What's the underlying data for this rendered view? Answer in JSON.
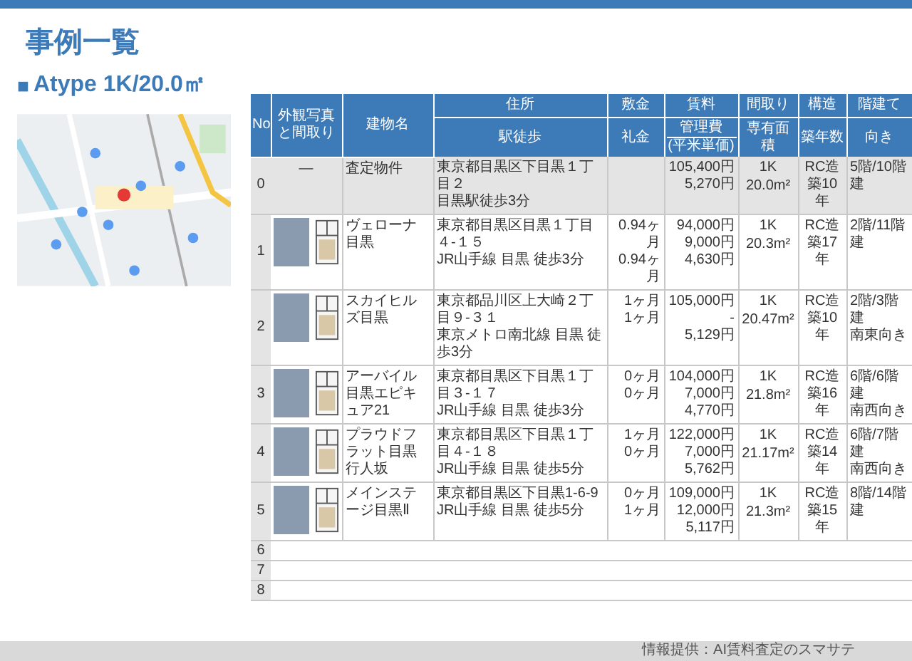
{
  "title": "事例一覧",
  "subtitle": {
    "marker": "■",
    "text": "Atype 1K/20.0㎡"
  },
  "table": {
    "columns": [
      {
        "label": "No"
      },
      {
        "label": "外観写真と間取り"
      },
      {
        "label": "建物名"
      },
      {
        "label": "住所",
        "sub": [
          "駅徒歩"
        ]
      },
      {
        "label": "敷金",
        "sub": [
          "礼金"
        ]
      },
      {
        "label": "賃料",
        "sub": [
          "管理費",
          "(平米単価)"
        ]
      },
      {
        "label": "間取り",
        "sub": [
          "専有面積"
        ]
      },
      {
        "label": "構造",
        "sub": [
          "築年数"
        ]
      },
      {
        "label": "階建て",
        "sub": [
          "向き"
        ]
      }
    ],
    "rows": [
      {
        "kind": "subject",
        "no": "0",
        "photo_text": "—",
        "name": "査定物件",
        "address": "東京都目黒区下目黒１丁目２",
        "station": "目黒駅徒歩3分",
        "deposit": "",
        "key_money": "",
        "rent": "105,400円",
        "fee": "",
        "unit_price": "5,270円",
        "layout": "1K",
        "area": "20.0m²",
        "structure": "RC造",
        "age": "築10年",
        "floor": "5階/10階建",
        "direction": ""
      },
      {
        "kind": "case",
        "no": "1",
        "name": "ヴェローナ目黒",
        "address": "東京都目黒区目黒１丁目４-１５",
        "station": "JR山手線 目黒 徒歩3分",
        "deposit": "0.94ヶ月",
        "key_money": "0.94ヶ月",
        "rent": "94,000円",
        "fee": "9,000円",
        "unit_price": "4,630円",
        "layout": "1K",
        "area": "20.3m²",
        "structure": "RC造",
        "age": "築17年",
        "floor": "2階/11階建",
        "direction": ""
      },
      {
        "kind": "case",
        "no": "2",
        "name": "スカイヒルズ目黒",
        "address": "東京都品川区上大崎２丁目９-３１",
        "station": "東京メトロ南北線 目黒 徒歩3分",
        "deposit": "1ヶ月",
        "key_money": "1ヶ月",
        "rent": "105,000円",
        "fee": "-",
        "unit_price": "5,129円",
        "layout": "1K",
        "area": "20.47m²",
        "structure": "RC造",
        "age": "築10年",
        "floor": "2階/3階建",
        "direction": "南東向き"
      },
      {
        "kind": "case",
        "no": "3",
        "name": "アーバイル目黒エピキュア21",
        "address": "東京都目黒区下目黒１丁目３-１７",
        "station": "JR山手線 目黒 徒歩3分",
        "deposit": "0ヶ月",
        "key_money": "0ヶ月",
        "rent": "104,000円",
        "fee": "7,000円",
        "unit_price": "4,770円",
        "layout": "1K",
        "area": "21.8m²",
        "structure": "RC造",
        "age": "築16年",
        "floor": "6階/6階建",
        "direction": "南西向き"
      },
      {
        "kind": "case",
        "no": "4",
        "name": "プラウドフラット目黒行人坂",
        "address": "東京都目黒区下目黒１丁目４-１８",
        "station": "JR山手線 目黒 徒歩5分",
        "deposit": "1ヶ月",
        "key_money": "0ヶ月",
        "rent": "122,000円",
        "fee": "7,000円",
        "unit_price": "5,762円",
        "layout": "1K",
        "area": "21.17m²",
        "structure": "RC造",
        "age": "築14年",
        "floor": "6階/7階建",
        "direction": "南西向き"
      },
      {
        "kind": "case",
        "no": "5",
        "name": "メインステージ目黒Ⅱ",
        "address": "東京都目黒区下目黒1-6-9",
        "station": "JR山手線 目黒 徒歩5分",
        "deposit": "0ヶ月",
        "key_money": "1ヶ月",
        "rent": "109,000円",
        "fee": "12,000円",
        "unit_price": "5,117円",
        "layout": "1K",
        "area": "21.3m²",
        "structure": "RC造",
        "age": "築15年",
        "floor": "8階/14階建",
        "direction": ""
      },
      {
        "kind": "empty",
        "no": "6"
      },
      {
        "kind": "empty",
        "no": "7"
      },
      {
        "kind": "empty",
        "no": "8"
      }
    ]
  },
  "footer": "情報提供：AI賃料査定のスマサテ"
}
